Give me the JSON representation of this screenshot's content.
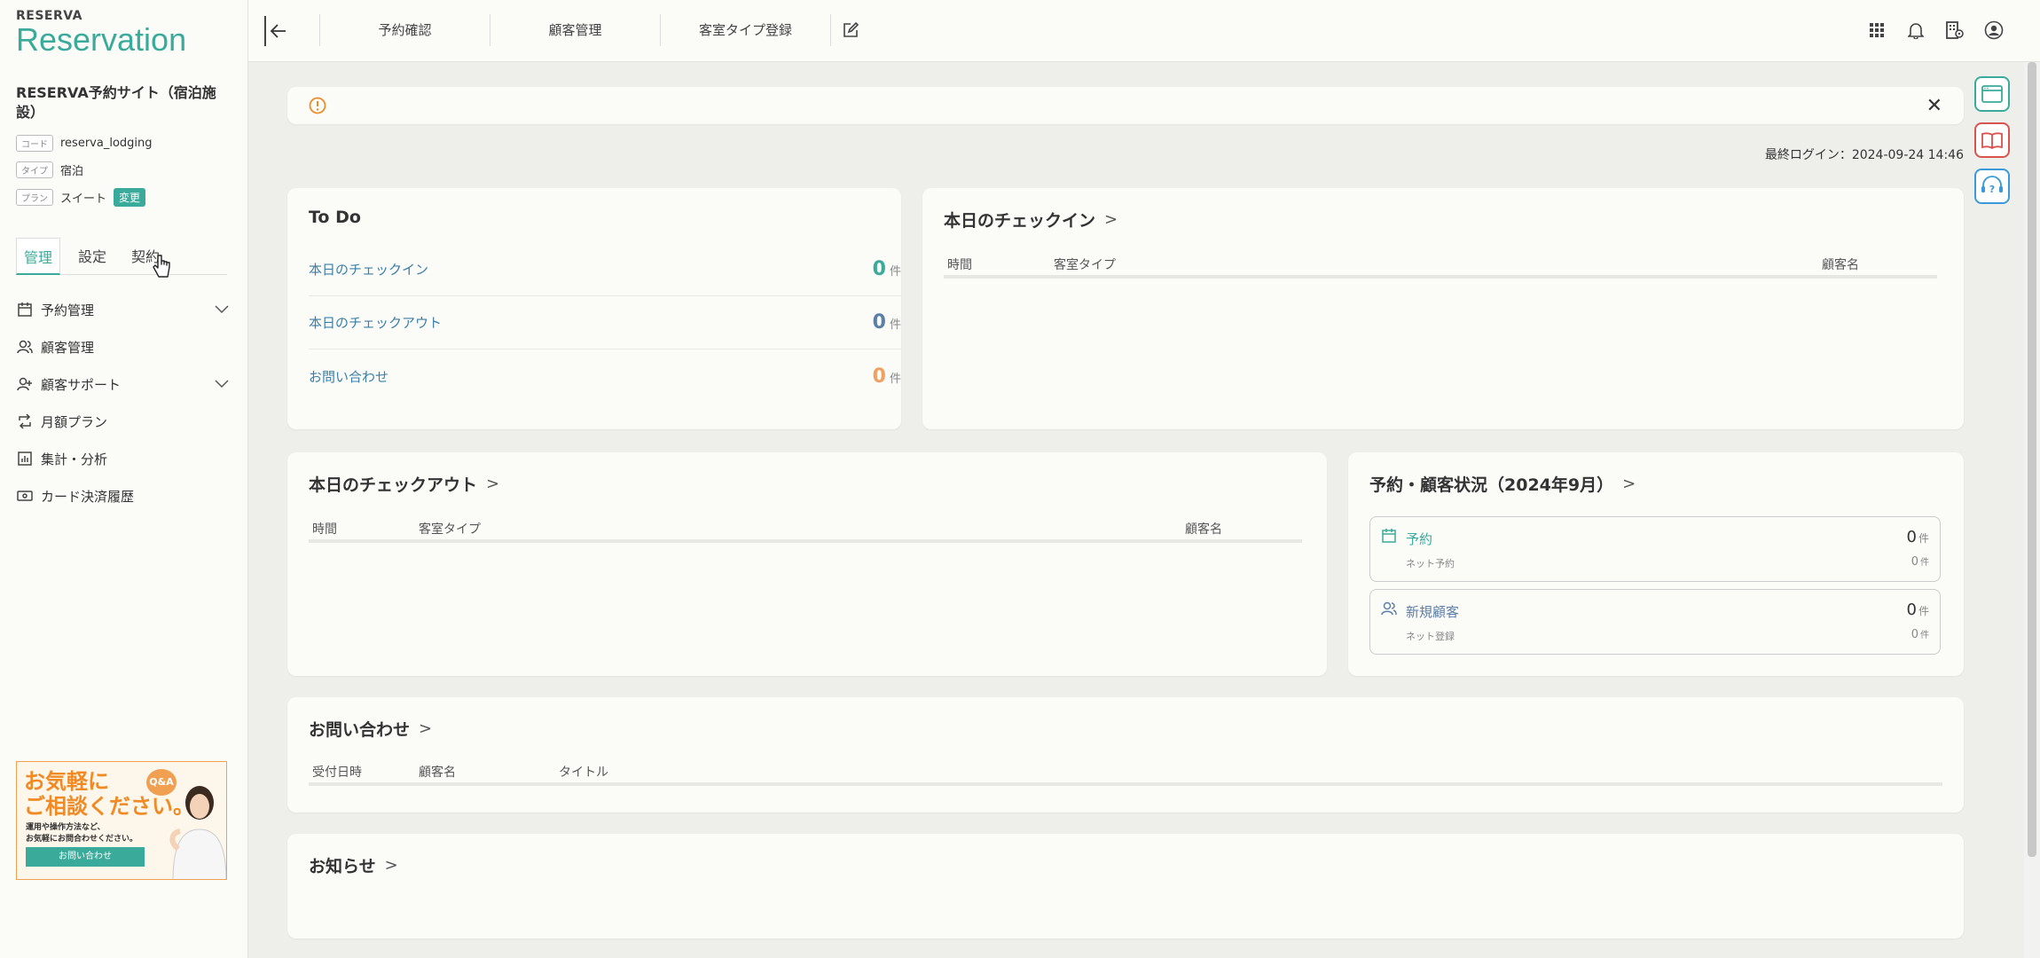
{
  "brand": {
    "small": "RESERVA",
    "name": "Reservation"
  },
  "site": {
    "name": "RESERVA予約サイト（宿泊施設）",
    "code_tag": "コード",
    "code": "reserva_lodging",
    "type_tag": "タイプ",
    "type": "宿泊",
    "plan_tag": "プラン",
    "plan": "スイート",
    "change_label": "変更"
  },
  "side_tabs": [
    "管理",
    "設定",
    "契約"
  ],
  "menu": [
    {
      "label": "予約管理",
      "icon": "calendar-icon",
      "expandable": true
    },
    {
      "label": "顧客管理",
      "icon": "users-icon",
      "expandable": false
    },
    {
      "label": "顧客サポート",
      "icon": "user-plus-icon",
      "expandable": true
    },
    {
      "label": "月額プラン",
      "icon": "repeat-icon",
      "expandable": false
    },
    {
      "label": "集計・分析",
      "icon": "bar-chart-icon",
      "expandable": false
    },
    {
      "label": "カード決済履歴",
      "icon": "card-icon",
      "expandable": false
    }
  ],
  "banner": {
    "title_line1": "お気軽に",
    "title_line2": "ご相談ください。",
    "sub_line1": "運用や操作方法など、",
    "sub_line2": "お気軽にお問合わせください。",
    "button": "お問い合わせ",
    "qa": "Q&A"
  },
  "topnav": [
    "予約確認",
    "顧客管理",
    "客室タイプ登録"
  ],
  "last_login": "最終ログイン：2024-09-24 14:46",
  "todo": {
    "title": "To Do",
    "rows": [
      {
        "label": "本日のチェックイン",
        "count": "0",
        "unit": "件",
        "color": "#3aaa9a"
      },
      {
        "label": "本日のチェックアウト",
        "count": "0",
        "unit": "件",
        "color": "#5b7fa8"
      },
      {
        "label": "お問い合わせ",
        "count": "0",
        "unit": "件",
        "color": "#f0a060"
      }
    ]
  },
  "checkin": {
    "title": "本日のチェックイン",
    "cols": [
      "時間",
      "客室タイプ",
      "顧客名"
    ]
  },
  "checkout": {
    "title": "本日のチェックアウト",
    "cols": [
      "時間",
      "客室タイプ",
      "顧客名"
    ]
  },
  "status": {
    "title": "予約・顧客状況（2024年9月）",
    "items": [
      {
        "label": "予約",
        "value": "0",
        "unit": "件",
        "sub": "ネット予約",
        "sub_value": "0",
        "sub_unit": "件"
      },
      {
        "label": "新規顧客",
        "value": "0",
        "unit": "件",
        "sub": "ネット登録",
        "sub_value": "0",
        "sub_unit": "件"
      }
    ]
  },
  "inquiry": {
    "title": "お問い合わせ",
    "cols": [
      "受付日時",
      "顧客名",
      "タイトル"
    ]
  },
  "news": {
    "title": "お知らせ"
  },
  "colors": {
    "accent": "#3aaa9a",
    "link": "#3a7fa8",
    "warning": "#f08a24",
    "danger": "#d9534f"
  }
}
